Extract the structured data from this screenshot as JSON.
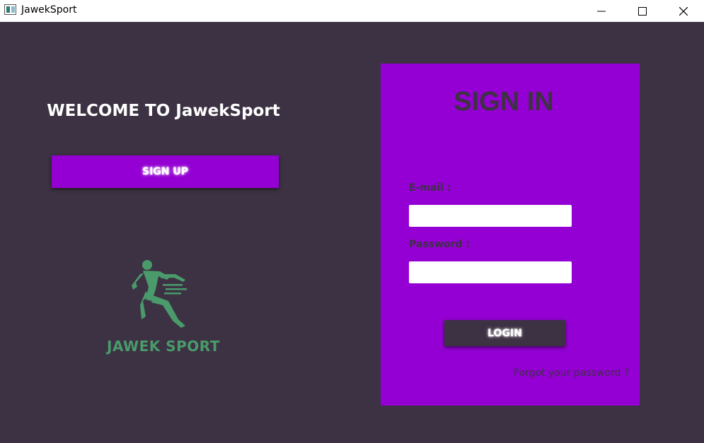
{
  "window": {
    "title": "JawekSport",
    "controls": {
      "minimize_icon": "minimize-icon",
      "maximize_icon": "maximize-icon",
      "close_icon": "close-icon"
    }
  },
  "left": {
    "welcome": "WELCOME TO JawekSport",
    "signup_label": "SIGN UP",
    "logo_text": "JAWEK SPORT",
    "logo_icon": "runner-icon"
  },
  "signin": {
    "title": "SIGN IN",
    "email_label": "E-mail :",
    "email_value": "",
    "password_label": "Password :",
    "password_value": "",
    "login_label": "LOGIN",
    "forgot_label": "Forgot your password ?"
  },
  "colors": {
    "background": "#3c3243",
    "accent": "#9400d3",
    "logo": "#4a9a6b",
    "text_dark": "#3c3243",
    "text_light": "#ffffff"
  }
}
